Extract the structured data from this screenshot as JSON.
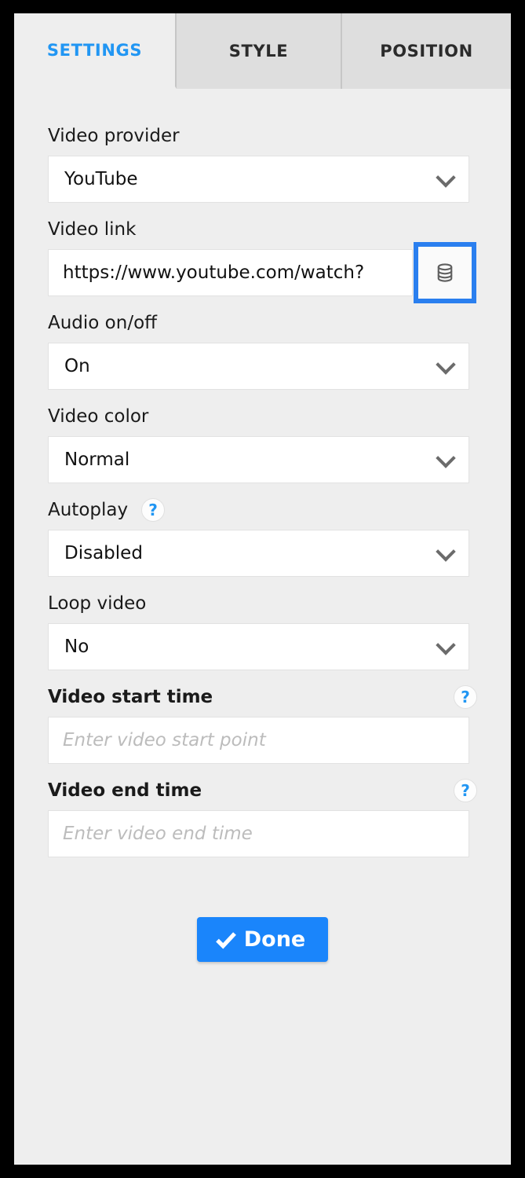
{
  "tabs": [
    {
      "label": "SETTINGS",
      "active": true
    },
    {
      "label": "STYLE",
      "active": false
    },
    {
      "label": "POSITION",
      "active": false
    }
  ],
  "fields": {
    "video_provider": {
      "label": "Video provider",
      "value": "YouTube"
    },
    "video_link": {
      "label": "Video link",
      "value": "https://www.youtube.com/watch?",
      "placeholder": "",
      "button_icon": "database-icon"
    },
    "audio": {
      "label": "Audio on/off",
      "value": "On"
    },
    "video_color": {
      "label": "Video color",
      "value": "Normal"
    },
    "autoplay": {
      "label": "Autoplay",
      "value": "Disabled",
      "help": "?"
    },
    "loop_video": {
      "label": "Loop video",
      "value": "No"
    },
    "video_start_time": {
      "label": "Video start time",
      "value": "",
      "placeholder": "Enter video start point",
      "help": "?"
    },
    "video_end_time": {
      "label": "Video end time",
      "value": "",
      "placeholder": "Enter video end time",
      "help": "?"
    }
  },
  "footer": {
    "done_label": "Done",
    "done_icon": "check-icon"
  },
  "colors": {
    "accent": "#2196f3",
    "button": "#1a85fb",
    "focus_ring": "#2a7fef",
    "panel_bg": "#eeeeee",
    "tab_inactive_bg": "#dedede"
  }
}
